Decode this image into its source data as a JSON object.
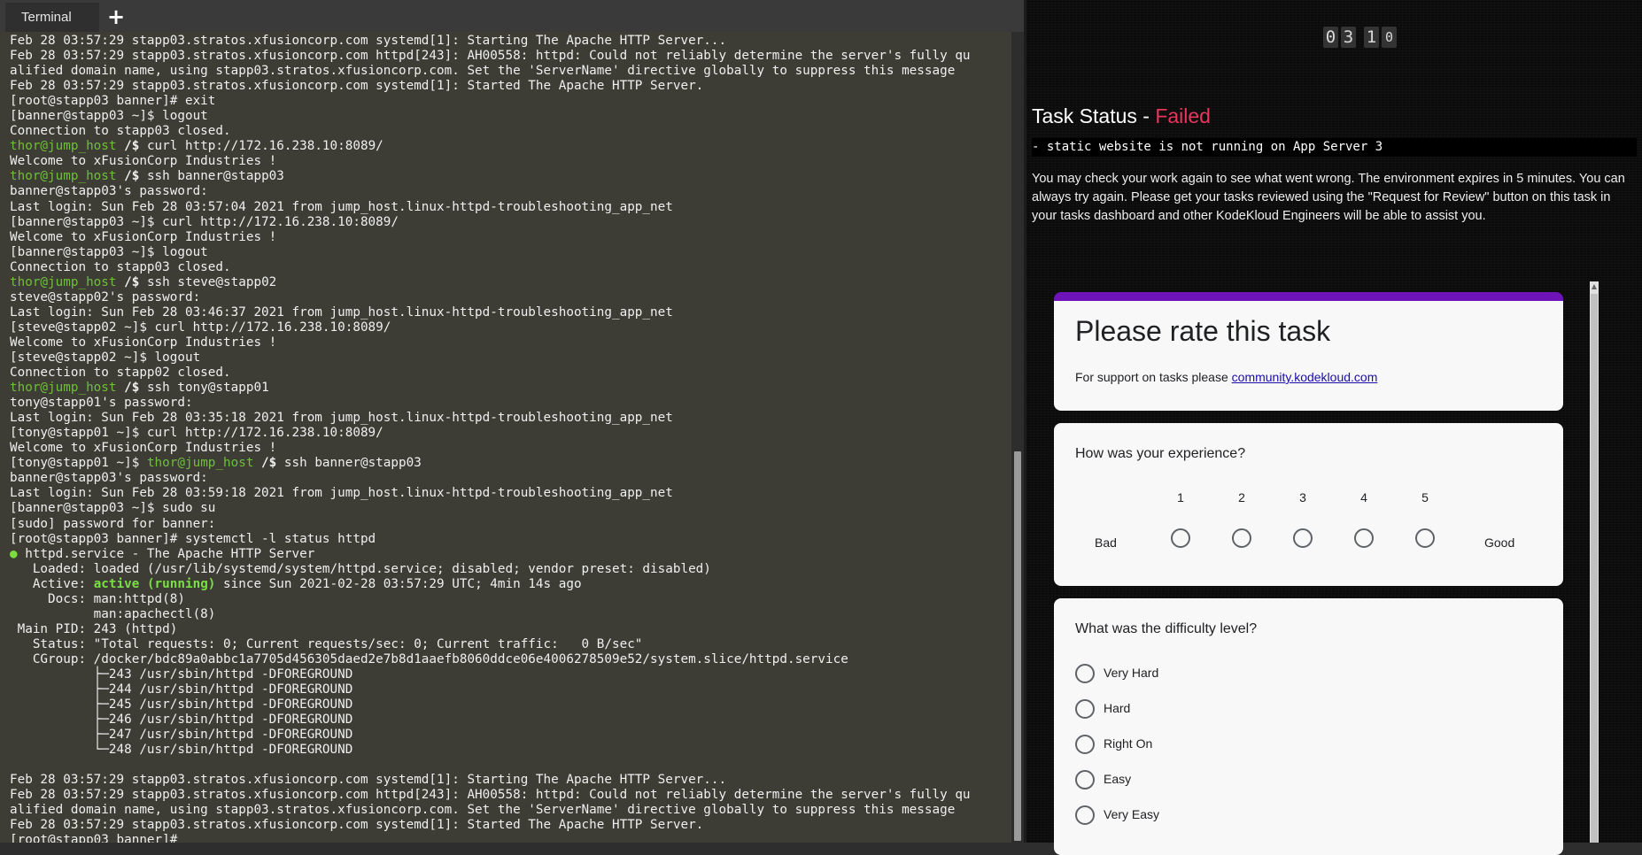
{
  "tabbar": {
    "tab_label": "Terminal",
    "new_tab_label": "+"
  },
  "terminal": {
    "lines": [
      {
        "t": "Feb 28 03:57:29 stapp03.stratos.xfusioncorp.com systemd[1]: Starting The Apache HTTP Server..."
      },
      {
        "t": "Feb 28 03:57:29 stapp03.stratos.xfusioncorp.com httpd[243]: AH00558: httpd: Could not reliably determine the server's fully qu"
      },
      {
        "t": "alified domain name, using stapp03.stratos.xfusioncorp.com. Set the 'ServerName' directive globally to suppress this message"
      },
      {
        "t": "Feb 28 03:57:29 stapp03.stratos.xfusioncorp.com systemd[1]: Started The Apache HTTP Server."
      },
      {
        "t": "[root@stapp03 banner]# exit"
      },
      {
        "t": "[banner@stapp03 ~]$ logout"
      },
      {
        "t": "Connection to stapp03 closed."
      },
      {
        "p": "thor@jump_host",
        "s": " /$",
        "t": " curl http://172.16.238.10:8089/"
      },
      {
        "t": "Welcome to xFusionCorp Industries !"
      },
      {
        "p": "thor@jump_host",
        "s": " /$",
        "t": " ssh banner@stapp03"
      },
      {
        "t": "banner@stapp03's password:"
      },
      {
        "t": "Last login: Sun Feb 28 03:57:04 2021 from jump_host.linux-httpd-troubleshooting_app_net"
      },
      {
        "t": "[banner@stapp03 ~]$ curl http://172.16.238.10:8089/"
      },
      {
        "t": "Welcome to xFusionCorp Industries !"
      },
      {
        "t": "[banner@stapp03 ~]$ logout"
      },
      {
        "t": "Connection to stapp03 closed."
      },
      {
        "p": "thor@jump_host",
        "s": " /$",
        "t": " ssh steve@stapp02"
      },
      {
        "t": "steve@stapp02's password:"
      },
      {
        "t": "Last login: Sun Feb 28 03:46:37 2021 from jump_host.linux-httpd-troubleshooting_app_net"
      },
      {
        "t": "[steve@stapp02 ~]$ curl http://172.16.238.10:8089/"
      },
      {
        "t": "Welcome to xFusionCorp Industries !"
      },
      {
        "t": "[steve@stapp02 ~]$ logout"
      },
      {
        "t": "Connection to stapp02 closed."
      },
      {
        "p": "thor@jump_host",
        "s": " /$",
        "t": " ssh tony@stapp01"
      },
      {
        "t": "tony@stapp01's password:"
      },
      {
        "t": "Last login: Sun Feb 28 03:35:18 2021 from jump_host.linux-httpd-troubleshooting_app_net"
      },
      {
        "t": "[tony@stapp01 ~]$ curl http://172.16.238.10:8089/"
      },
      {
        "t": "Welcome to xFusionCorp Industries !"
      },
      {
        "pre": "[tony@stapp01 ~]$ ",
        "p": "thor@jump_host",
        "s": " /$",
        "t": " ssh banner@stapp03"
      },
      {
        "t": "banner@stapp03's password:"
      },
      {
        "t": "Last login: Sun Feb 28 03:59:18 2021 from jump_host.linux-httpd-troubleshooting_app_net"
      },
      {
        "t": "[banner@stapp03 ~]$ sudo su"
      },
      {
        "t": "[sudo] password for banner:"
      },
      {
        "t": "[root@stapp03 banner]# systemctl -l status httpd"
      },
      {
        "dot": "●",
        "t": " httpd.service - The Apache HTTP Server"
      },
      {
        "t": "   Loaded: loaded (/usr/lib/systemd/system/httpd.service; disabled; vendor preset: disabled)"
      },
      {
        "pre": "   Active: ",
        "a": "active (running)",
        "t": " since Sun 2021-02-28 03:57:29 UTC; 4min 14s ago"
      },
      {
        "t": "     Docs: man:httpd(8)"
      },
      {
        "t": "           man:apachectl(8)"
      },
      {
        "t": " Main PID: 243 (httpd)"
      },
      {
        "t": "   Status: \"Total requests: 0; Current requests/sec: 0; Current traffic:   0 B/sec\""
      },
      {
        "t": "   CGroup: /docker/bdc89a0abbc1a7705d456305daed2e7b8d1aaefb8060ddce06e4006278509e52/system.slice/httpd.service"
      },
      {
        "t": "           ├─243 /usr/sbin/httpd -DFOREGROUND"
      },
      {
        "t": "           ├─244 /usr/sbin/httpd -DFOREGROUND"
      },
      {
        "t": "           ├─245 /usr/sbin/httpd -DFOREGROUND"
      },
      {
        "t": "           ├─246 /usr/sbin/httpd -DFOREGROUND"
      },
      {
        "t": "           ├─247 /usr/sbin/httpd -DFOREGROUND"
      },
      {
        "t": "           └─248 /usr/sbin/httpd -DFOREGROUND"
      },
      {
        "t": ""
      },
      {
        "t": "Feb 28 03:57:29 stapp03.stratos.xfusioncorp.com systemd[1]: Starting The Apache HTTP Server..."
      },
      {
        "t": "Feb 28 03:57:29 stapp03.stratos.xfusioncorp.com httpd[243]: AH00558: httpd: Could not reliably determine the server's fully qu"
      },
      {
        "t": "alified domain name, using stapp03.stratos.xfusioncorp.com. Set the 'ServerName' directive globally to suppress this message"
      },
      {
        "t": "Feb 28 03:57:29 stapp03.stratos.xfusioncorp.com systemd[1]: Started The Apache HTTP Server."
      },
      {
        "t": "[root@stapp03 banner]#"
      }
    ]
  },
  "timer": {
    "d1": "0",
    "d2": "3",
    "d3": "1",
    "d4": "0"
  },
  "task": {
    "title_prefix": "Task Status - ",
    "status": "Failed",
    "status_color": "#e8365d",
    "message": "- static website is not running on App Server 3",
    "description": "You may check your work again to see what went wrong. The environment expires in 5 minutes. You can always try again. Please get your tasks reviewed using the \"Request for Review\" button on this task in your tasks dashboard and other KodeKloud Engineers will be able to assist you."
  },
  "form": {
    "title": "Please rate this task",
    "support_prefix": "For support on tasks please ",
    "support_link": "community.kodekloud.com",
    "accent_color": "#6d13b8",
    "experience": {
      "question": "How was your experience?",
      "scale": [
        "1",
        "2",
        "3",
        "4",
        "5"
      ],
      "low_label": "Bad",
      "high_label": "Good"
    },
    "difficulty": {
      "question": "What was the difficulty level?",
      "options": [
        "Very Hard",
        "Hard",
        "Right On",
        "Easy",
        "Very Easy"
      ]
    }
  }
}
